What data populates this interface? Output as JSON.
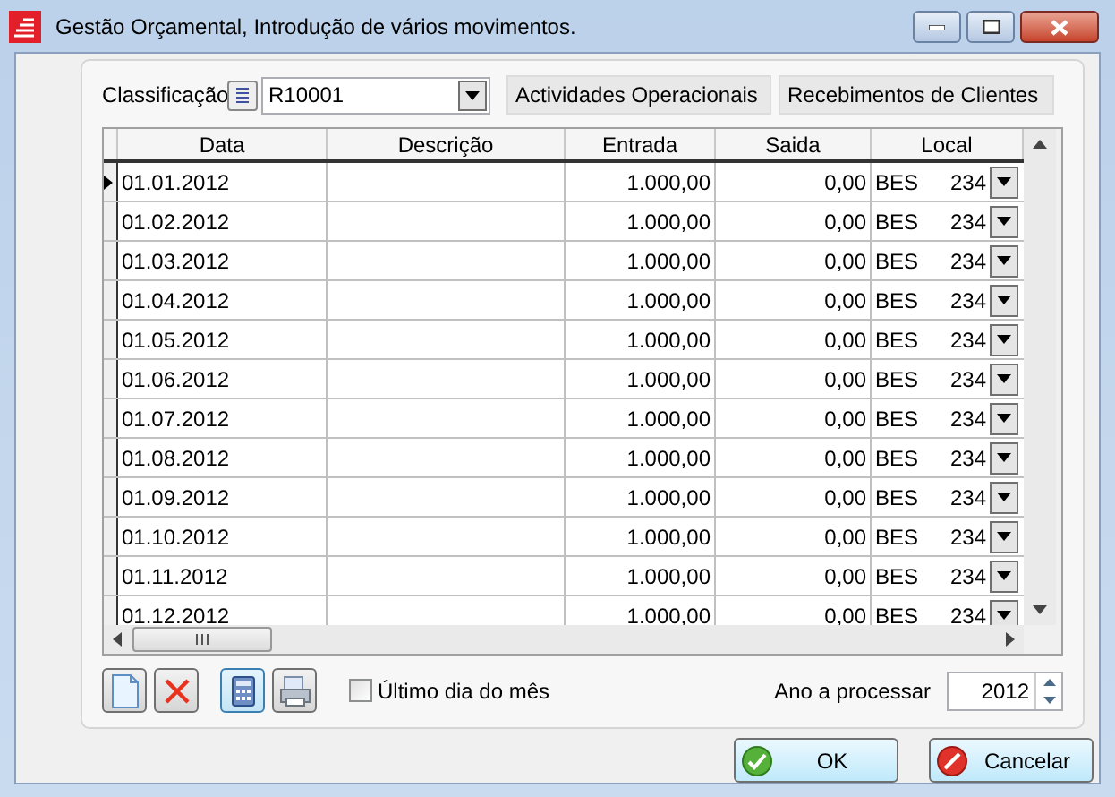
{
  "window": {
    "title": "Gestão Orçamental, Introdução de vários movimentos."
  },
  "classification": {
    "label": "Classificação",
    "value": "R10001",
    "category": "Actividades Operacionais",
    "subcategory": "Recebimentos de Clientes"
  },
  "table": {
    "columns": [
      "Data",
      "Descrição",
      "Entrada",
      "Saida",
      "Local"
    ],
    "rows": [
      {
        "date": "01.01.2012",
        "description": "",
        "in": "1.000,00",
        "out": "0,00",
        "local": "BES",
        "code": "234",
        "current": true
      },
      {
        "date": "01.02.2012",
        "description": "",
        "in": "1.000,00",
        "out": "0,00",
        "local": "BES",
        "code": "234",
        "current": false
      },
      {
        "date": "01.03.2012",
        "description": "",
        "in": "1.000,00",
        "out": "0,00",
        "local": "BES",
        "code": "234",
        "current": false
      },
      {
        "date": "01.04.2012",
        "description": "",
        "in": "1.000,00",
        "out": "0,00",
        "local": "BES",
        "code": "234",
        "current": false
      },
      {
        "date": "01.05.2012",
        "description": "",
        "in": "1.000,00",
        "out": "0,00",
        "local": "BES",
        "code": "234",
        "current": false
      },
      {
        "date": "01.06.2012",
        "description": "",
        "in": "1.000,00",
        "out": "0,00",
        "local": "BES",
        "code": "234",
        "current": false
      },
      {
        "date": "01.07.2012",
        "description": "",
        "in": "1.000,00",
        "out": "0,00",
        "local": "BES",
        "code": "234",
        "current": false
      },
      {
        "date": "01.08.2012",
        "description": "",
        "in": "1.000,00",
        "out": "0,00",
        "local": "BES",
        "code": "234",
        "current": false
      },
      {
        "date": "01.09.2012",
        "description": "",
        "in": "1.000,00",
        "out": "0,00",
        "local": "BES",
        "code": "234",
        "current": false
      },
      {
        "date": "01.10.2012",
        "description": "",
        "in": "1.000,00",
        "out": "0,00",
        "local": "BES",
        "code": "234",
        "current": false
      },
      {
        "date": "01.11.2012",
        "description": "",
        "in": "1.000,00",
        "out": "0,00",
        "local": "BES",
        "code": "234",
        "current": false
      },
      {
        "date": "01.12.2012",
        "description": "",
        "in": "1.000,00",
        "out": "0,00",
        "local": "BES",
        "code": "234",
        "current": false
      }
    ]
  },
  "toolbar": [
    {
      "kind": "new",
      "selected": false
    },
    {
      "kind": "delete",
      "selected": false
    },
    {
      "kind": "calculator",
      "selected": true
    },
    {
      "kind": "print",
      "selected": false
    }
  ],
  "last_day": {
    "label": "Último dia do mês",
    "checked": false
  },
  "year": {
    "label": "Ano a processar",
    "value": "2012"
  },
  "buttons": [
    {
      "kind": "ok",
      "label": "OK"
    },
    {
      "kind": "cancel",
      "label": "Cancelar"
    }
  ]
}
